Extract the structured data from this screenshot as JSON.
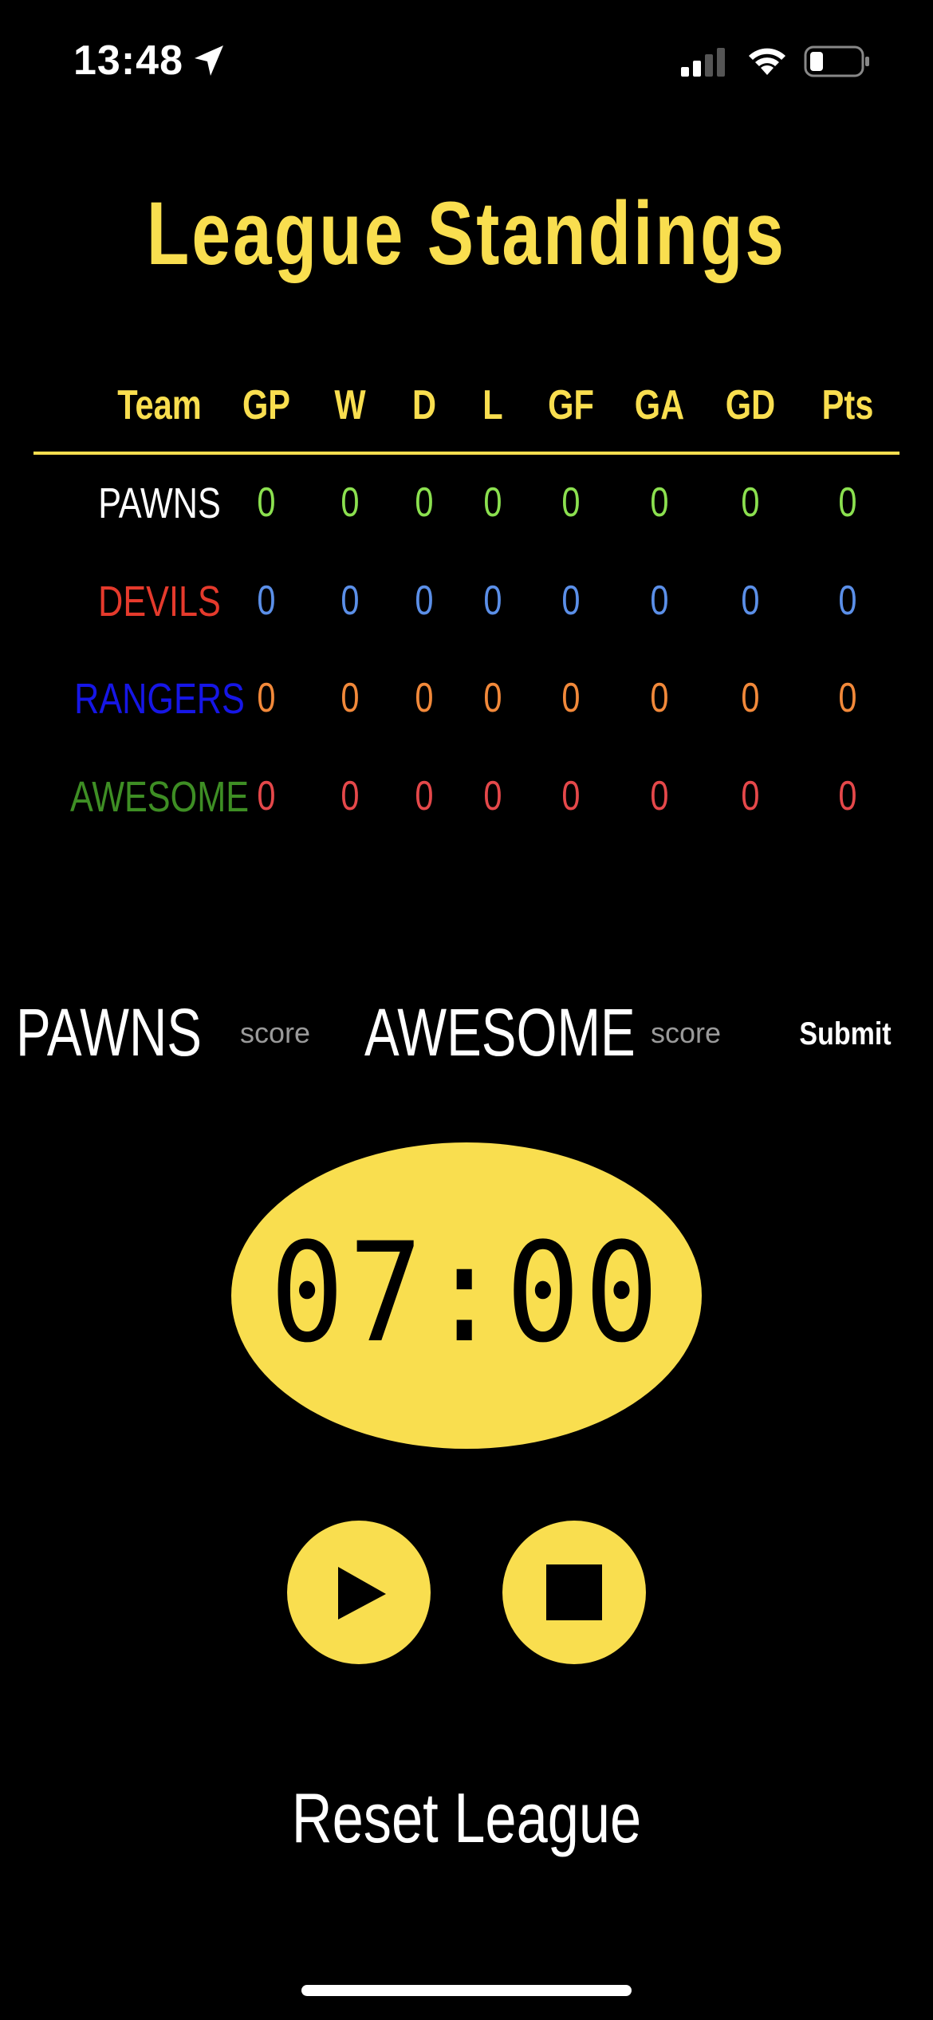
{
  "status_bar": {
    "time": "13:48",
    "icons": [
      "location-arrow-icon",
      "signal-icon",
      "wifi-icon",
      "battery-icon"
    ]
  },
  "title": "League Standings",
  "table": {
    "headers": [
      "Team",
      "GP",
      "W",
      "D",
      "L",
      "GF",
      "GA",
      "GD",
      "Pts"
    ],
    "rows": [
      {
        "team": "PAWNS",
        "team_color": "#FFFFFF",
        "value_color": "#8BE04F",
        "values": [
          "0",
          "0",
          "0",
          "0",
          "0",
          "0",
          "0",
          "0"
        ]
      },
      {
        "team": "DEVILS",
        "team_color": "#E53A2C",
        "value_color": "#5B8FE8",
        "values": [
          "0",
          "0",
          "0",
          "0",
          "0",
          "0",
          "0",
          "0"
        ]
      },
      {
        "team": "RANGERS",
        "team_color": "#1616E6",
        "value_color": "#F2893A",
        "values": [
          "0",
          "0",
          "0",
          "0",
          "0",
          "0",
          "0",
          "0"
        ]
      },
      {
        "team": "AWESOME",
        "team_color": "#3E8E24",
        "value_color": "#E5484A",
        "values": [
          "0",
          "0",
          "0",
          "0",
          "0",
          "0",
          "0",
          "0"
        ]
      }
    ]
  },
  "score_entry": {
    "home_team": "PAWNS",
    "away_team": "AWESOME",
    "home_placeholder": "score",
    "away_placeholder": "score",
    "submit_label": "Submit"
  },
  "timer": {
    "display": "07:00"
  },
  "controls": {
    "play_icon": "play-icon",
    "stop_icon": "stop-icon"
  },
  "reset_label": "Reset League",
  "colors": {
    "accent": "#F9DE4F",
    "background": "#000000"
  }
}
